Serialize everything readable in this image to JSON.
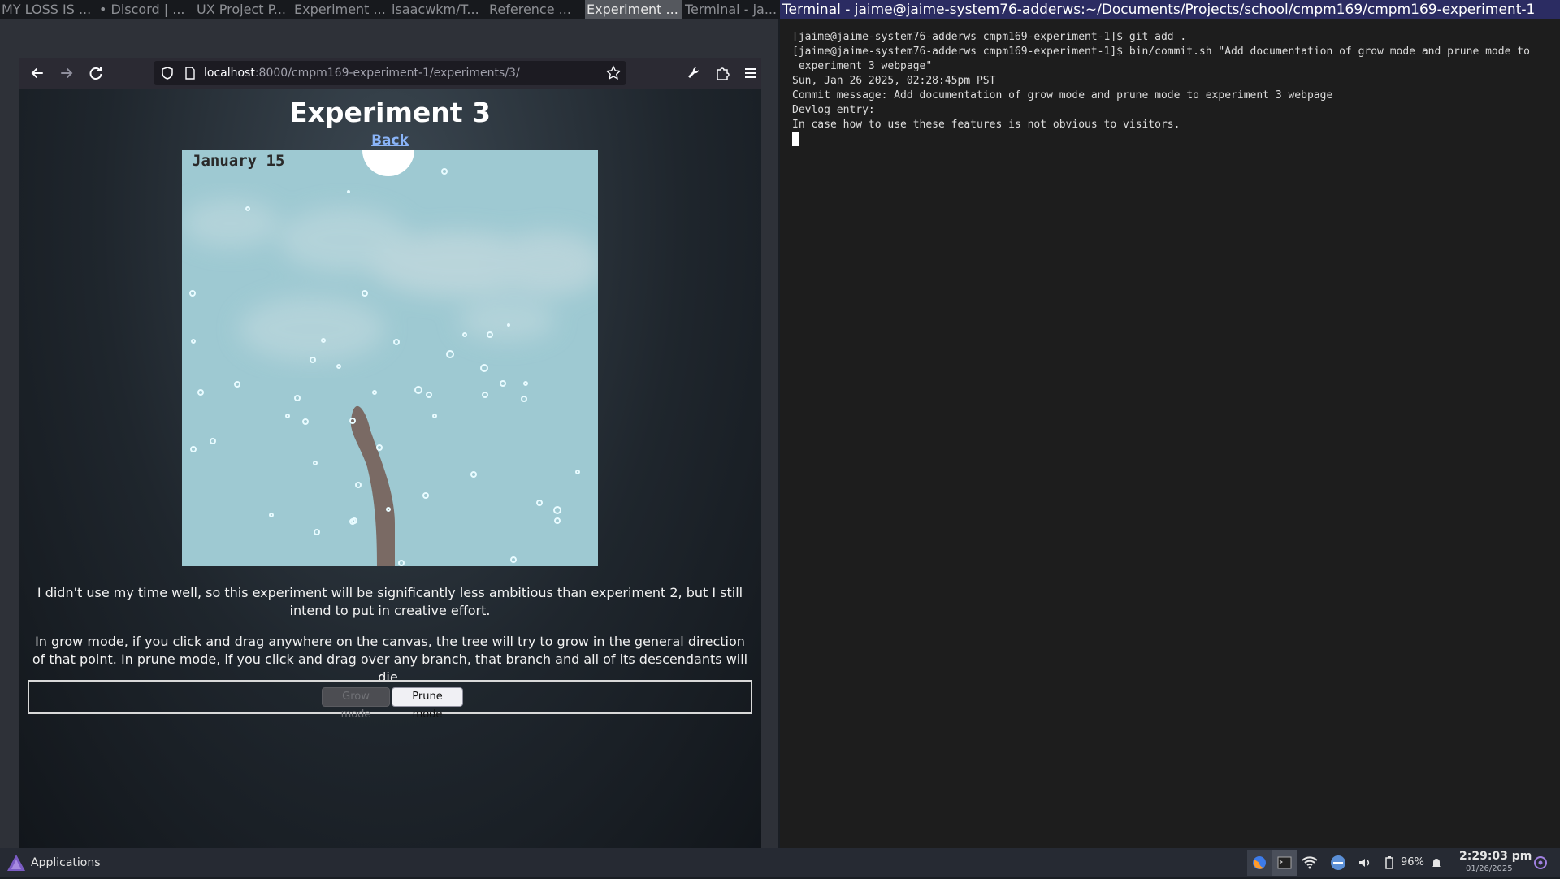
{
  "window_tabs": [
    {
      "label": "MY LOSS IS ...",
      "active": false
    },
    {
      "label": "• Discord | ...",
      "active": false
    },
    {
      "label": "UX Project P...",
      "active": false
    },
    {
      "label": "Experiment ...",
      "active": false
    },
    {
      "label": "isaacwkm/T...",
      "active": false
    },
    {
      "label": "Reference ...",
      "active": false
    },
    {
      "label": "Experiment ...",
      "active": true
    },
    {
      "label": "Terminal - ja...",
      "active": false
    }
  ],
  "terminal_title": "Terminal - jaime@jaime-system76-adderws:~/Documents/Projects/school/cmpm169/cmpm169-experiment-1",
  "browser": {
    "url_host": "localhost",
    "url_path": ":8000/cmpm169-experiment-1/experiments/3/",
    "icons": {
      "back": "arrow-left-icon",
      "forward": "arrow-right-icon",
      "reload": "reload-icon",
      "shield": "shield-icon",
      "page": "page-icon",
      "bookmark": "star-icon",
      "tools": "wrench-icon",
      "extensions": "puzzle-icon",
      "menu": "hamburger-menu-icon"
    }
  },
  "page": {
    "title": "Experiment 3",
    "back_link": "Back",
    "canvas_date": "January 15",
    "paragraph1": "I didn't use my time well, so this experiment will be significantly less ambitious than experiment 2, but I still intend to put in creative effort.",
    "paragraph2": "In grow mode, if you click and drag anywhere on the canvas, the tree will try to grow in the general direction of that point. In prune mode, if you click and drag over any branch, that branch and all of its descendants will die.",
    "grow_button": "Grow mode",
    "prune_button": "Prune mode",
    "grow_enabled": false
  },
  "terminal": {
    "lines": [
      "[jaime@jaime-system76-adderws cmpm169-experiment-1]$ git add .",
      "[jaime@jaime-system76-adderws cmpm169-experiment-1]$ bin/commit.sh \"Add documentation of grow mode and prune mode to",
      " experiment 3 webpage\"",
      "Sun, Jan 26 2025, 02:28:45pm PST",
      "Commit message: Add documentation of grow mode and prune mode to experiment 3 webpage",
      "Devlog entry:",
      "In case how to use these features is not obvious to visitors."
    ]
  },
  "taskbar": {
    "apps_label": "Applications",
    "battery": "96%",
    "time": "2:29:03 pm",
    "date": "01/26/2025",
    "icons": [
      "firefox-icon",
      "terminal-icon",
      "wifi-icon",
      "network-icon",
      "volume-icon",
      "battery-icon",
      "bell-icon",
      "power-icon"
    ]
  },
  "colors": {
    "canvas_sky": "#9ec9d2",
    "tree_trunk": "#7a6a64",
    "snowflake": "#e8fbff",
    "terminal_title_bg": "#2b2c62",
    "link": "#8ab4f8"
  }
}
